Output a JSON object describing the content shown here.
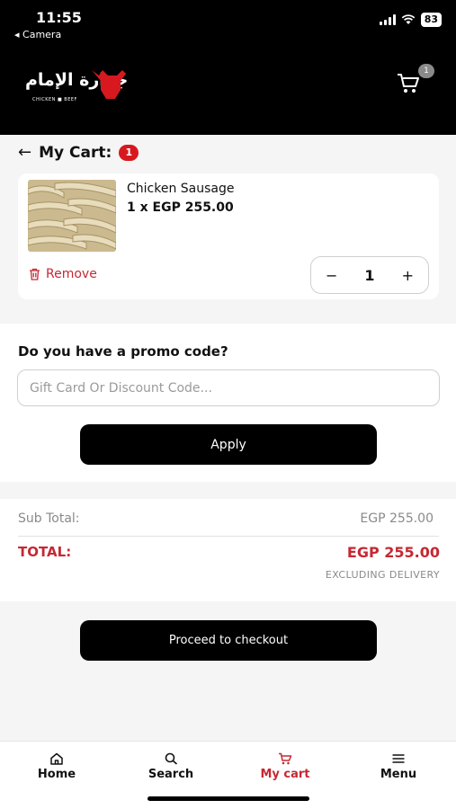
{
  "status_bar": {
    "time": "11:55",
    "back_app": "◂ Camera",
    "battery": "83"
  },
  "header": {
    "logo_text": "جزارة الإمام",
    "logo_subtext": "CHICKEN ■ BEEF",
    "cart_badge": "1"
  },
  "cart": {
    "title": "My Cart:",
    "count": "1",
    "items": [
      {
        "name": "Chicken Sausage",
        "price_line": "1 x EGP 255.00",
        "remove_label": "Remove",
        "quantity": "1"
      }
    ]
  },
  "promo": {
    "question": "Do you have a promo code?",
    "placeholder": "Gift Card Or Discount Code...",
    "apply_label": "Apply"
  },
  "totals": {
    "subtotal_label": "Sub Total:",
    "subtotal_value": "EGP 255.00",
    "total_label": "TOTAL:",
    "total_value": "EGP 255.00",
    "note": "EXCLUDING DELIVERY"
  },
  "checkout_label": "Proceed to checkout",
  "tabs": [
    {
      "label": "Home",
      "icon": "home-icon"
    },
    {
      "label": "Search",
      "icon": "search-icon"
    },
    {
      "label": "My cart",
      "icon": "cart-icon",
      "active": true
    },
    {
      "label": "Menu",
      "icon": "menu-icon"
    }
  ],
  "colors": {
    "accent": "#c62833",
    "badge": "#d7191f",
    "header_bg": "#000000"
  }
}
